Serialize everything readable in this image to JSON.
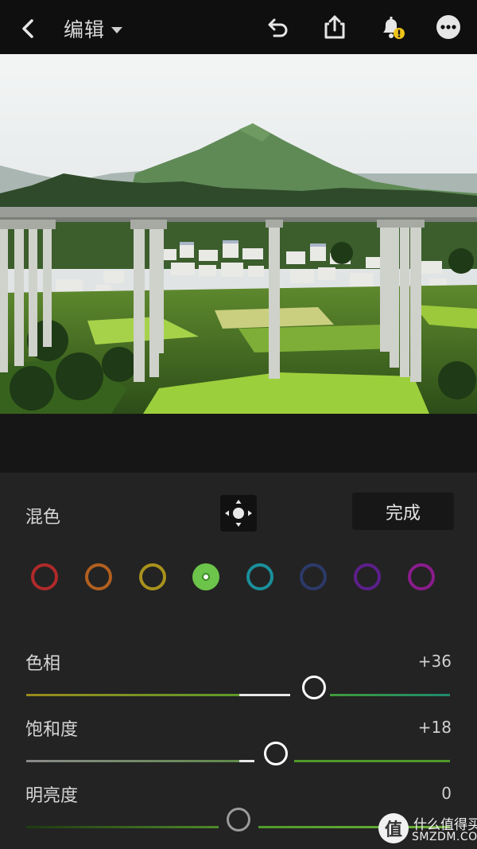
{
  "header": {
    "title": "编辑",
    "icons": [
      "back-icon",
      "caret-down-icon",
      "undo-icon",
      "share-icon",
      "notification-bell-warning-icon",
      "more-options-icon"
    ]
  },
  "colors": {
    "toolbar_bg": "#0f0f0f",
    "panel_bg": "#232323",
    "accent_green": "#6cc44a",
    "warning_yellow": "#f0c419"
  },
  "panel": {
    "label": "混色",
    "target_tool_icon": "targeted-adjustment-icon",
    "done_label": "完成",
    "swatches": [
      {
        "name": "red",
        "color": "#b02a2a",
        "active": false
      },
      {
        "name": "orange",
        "color": "#b25f1f",
        "active": false
      },
      {
        "name": "yellow",
        "color": "#a8921c",
        "active": false
      },
      {
        "name": "green",
        "color": "#6cc44a",
        "active": true
      },
      {
        "name": "aqua",
        "color": "#1a8f9a",
        "active": false
      },
      {
        "name": "blue",
        "color": "#2c3a6a",
        "active": false
      },
      {
        "name": "purple",
        "color": "#5c1f8c",
        "active": false
      },
      {
        "name": "magenta",
        "color": "#8a1c8c",
        "active": false
      }
    ],
    "sliders": [
      {
        "label": "色相",
        "value": "+36",
        "level": 0.68
      },
      {
        "label": "饱和度",
        "value": "+18",
        "level": 0.59
      },
      {
        "label": "明亮度",
        "value": "0",
        "level": 0.5
      }
    ]
  },
  "watermark": {
    "glyph": "值",
    "cn": "什么值得买",
    "en": "SMZDM.COM"
  }
}
